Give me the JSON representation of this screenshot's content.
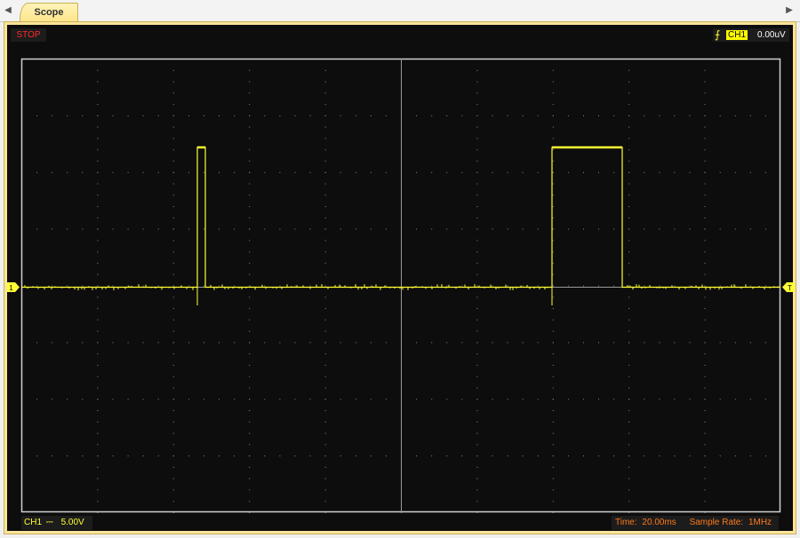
{
  "tabbar": {
    "left_arrow": "◀",
    "right_arrow": "▶",
    "tabs": [
      {
        "label": "Scope"
      }
    ]
  },
  "status": {
    "run_state": "STOP"
  },
  "trigger": {
    "channel": "CH1",
    "level": "0.00uV",
    "marker_label": "T"
  },
  "channel_marker": {
    "label": "1"
  },
  "bottom": {
    "channel": "CH1",
    "coupling_symbol": "⎓",
    "volts_per_div": "5.00V",
    "time_label": "Time:",
    "time_per_div": "20.00ms",
    "sample_rate_label": "Sample Rate:",
    "sample_rate": "1MHz"
  },
  "colors": {
    "trace": "#ffff33",
    "grid": "#8a8a8a",
    "stop": "#ff2a2a",
    "info_orange": "#ff7a1a",
    "frame": "#fbe49a"
  }
}
